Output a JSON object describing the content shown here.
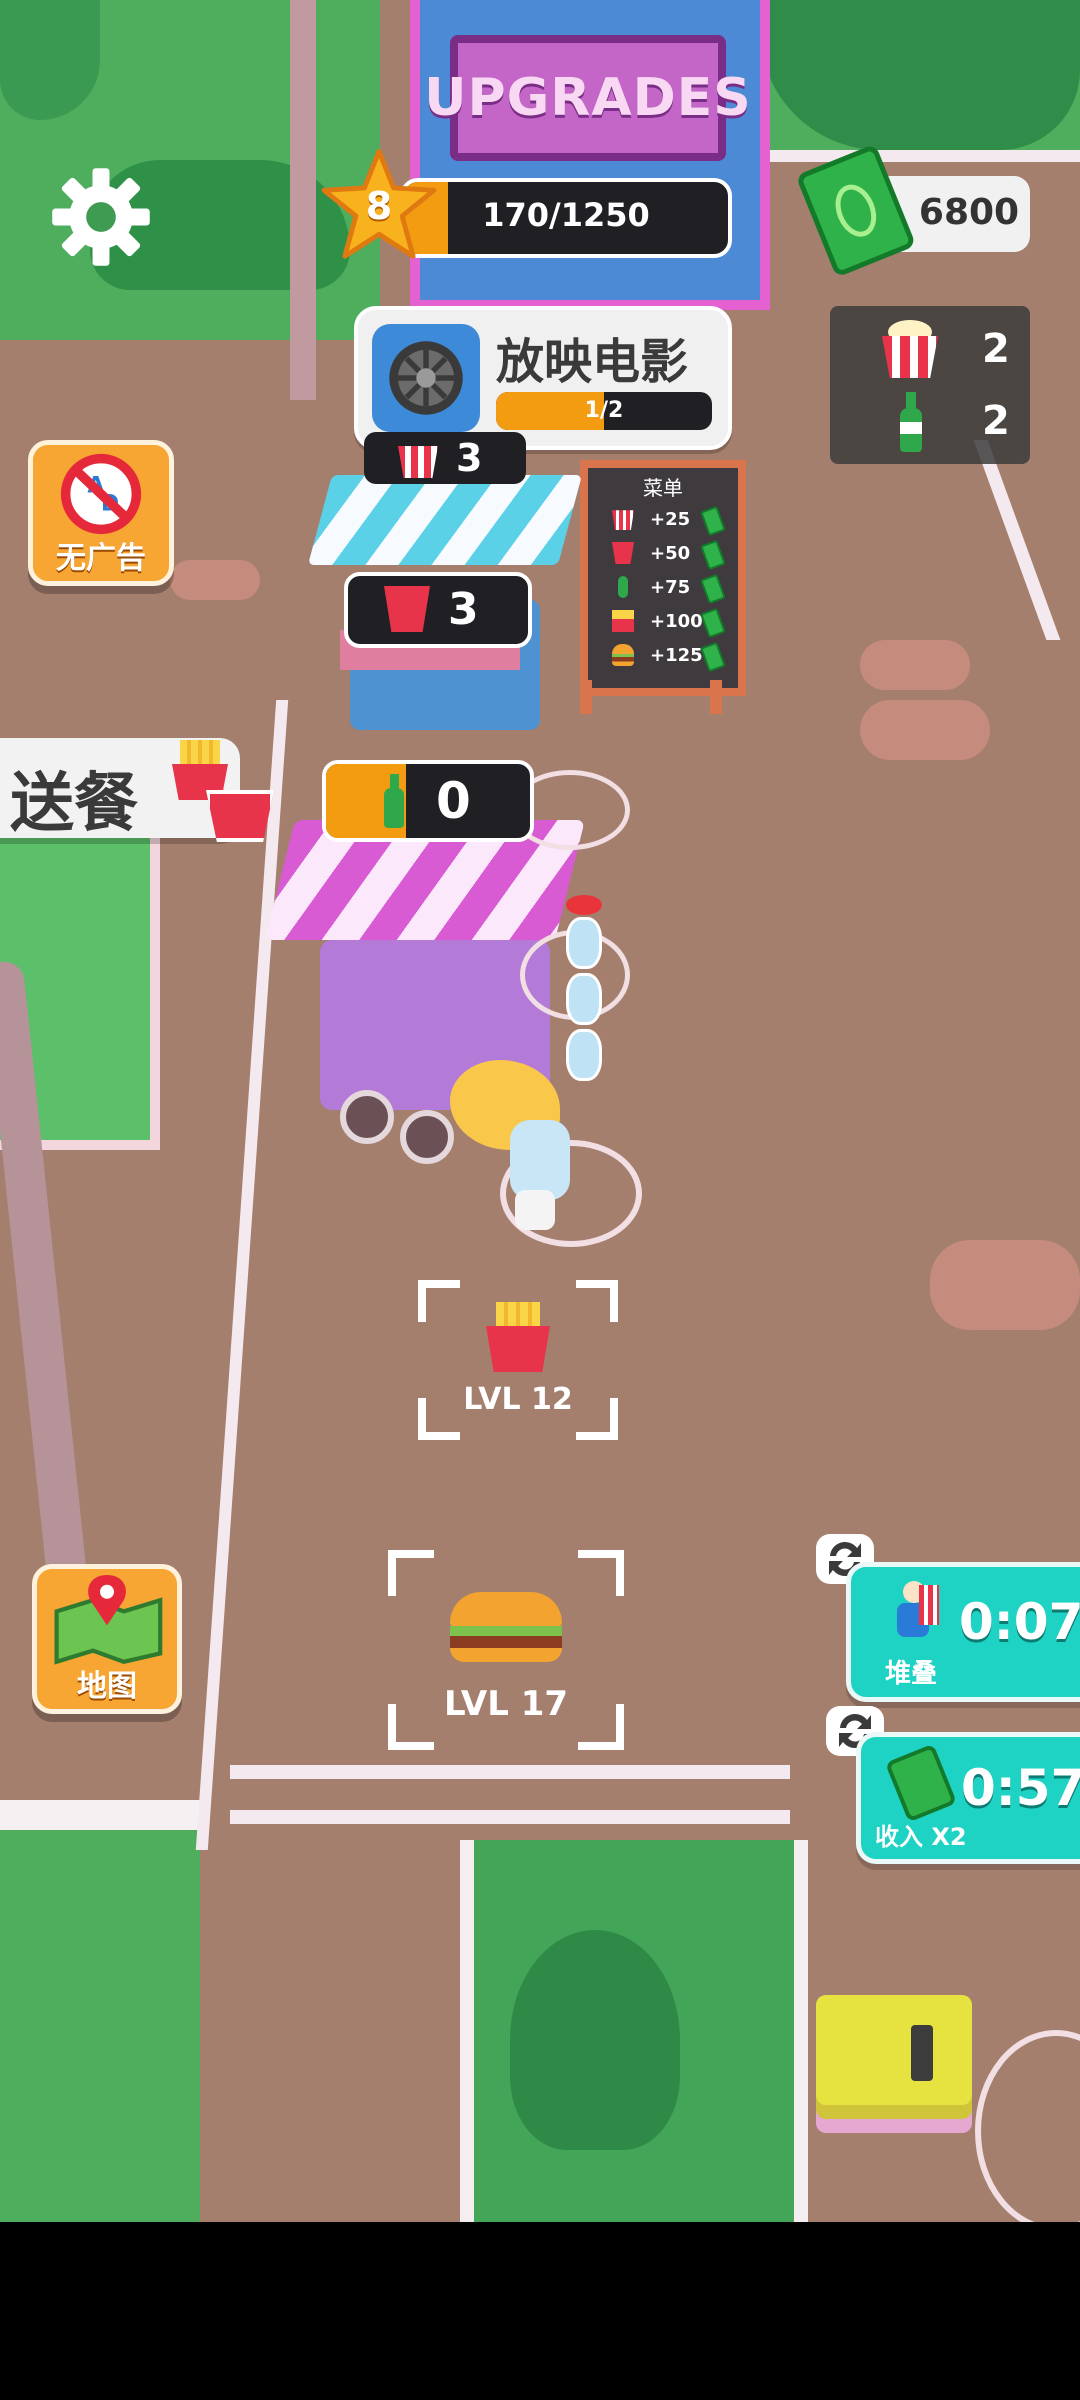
{
  "hud": {
    "level": "8",
    "xp_text": "170/1250",
    "xp_progress": 0.136,
    "cash": "6800",
    "task_title": "放映电影",
    "task_progress_text": "1/2",
    "task_progress": 0.5,
    "inventory": [
      {
        "icon": "popcorn-icon",
        "count": "2"
      },
      {
        "icon": "bottle-icon",
        "count": "2"
      }
    ]
  },
  "scene_labels": {
    "upgrades_sign": "UPGRADES",
    "no_ads": "无广告",
    "delivery": "送餐",
    "map": "地图",
    "popcorn_stall_count": "3",
    "cup_stall_count": "3",
    "bottle_stall_count": "0",
    "fries_slot_level": "LVL 12",
    "burger_slot_level": "LVL 17"
  },
  "menu_board": {
    "title": "菜单",
    "items": [
      {
        "icon": "popcorn-icon",
        "price": "+25"
      },
      {
        "icon": "cup-icon",
        "price": "+50"
      },
      {
        "icon": "bottle-icon",
        "price": "+75"
      },
      {
        "icon": "fries-icon",
        "price": "+100"
      },
      {
        "icon": "burger-icon",
        "price": "+125"
      }
    ]
  },
  "boosts": [
    {
      "label": "堆叠",
      "timer": "0:07"
    },
    {
      "label": "收入 X2",
      "timer": "0:57"
    }
  ],
  "colors": {
    "ground": "#a57f6e",
    "grass": "#4aa85a",
    "teal_boost": "#1ed2c4",
    "orange_bar": "#f39c12",
    "pink_accent": "#ea6fd8"
  }
}
